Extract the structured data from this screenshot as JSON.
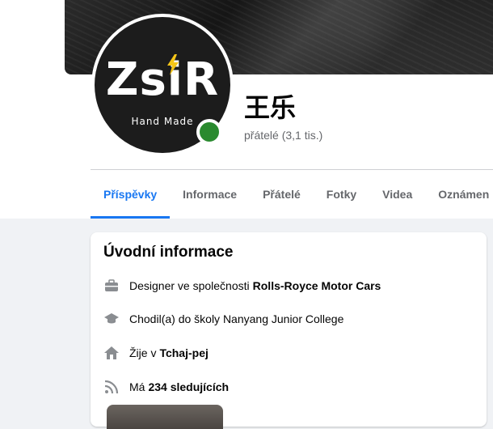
{
  "profile": {
    "name": "王乐",
    "friends_text": "přátelé (3,1 tis.)",
    "avatar_logo_text": "ZsiR",
    "avatar_logo_subtext": "Hand  Made",
    "online_color": "#2a8a2f"
  },
  "tabs": [
    {
      "label": "Příspěvky",
      "active": true
    },
    {
      "label": "Informace",
      "active": false
    },
    {
      "label": "Přátelé",
      "active": false
    },
    {
      "label": "Fotky",
      "active": false
    },
    {
      "label": "Videa",
      "active": false
    },
    {
      "label": "Oznámen",
      "active": false
    }
  ],
  "intro": {
    "title": "Úvodní informace",
    "work": {
      "prefix": "Designer ve společnosti ",
      "value": "Rolls-Royce Motor Cars",
      "icon": "briefcase-icon"
    },
    "school": {
      "prefix": "Chodil(a) do školy Nanyang Junior College",
      "icon": "graduation-cap-icon"
    },
    "home": {
      "prefix": "Žije v ",
      "value": "Tchaj-pej",
      "icon": "home-icon"
    },
    "followers": {
      "prefix": "Má ",
      "value": "234 sledujících",
      "icon": "rss-icon"
    }
  },
  "colors": {
    "accent": "#1877f2",
    "muted": "#65676b",
    "background": "#f0f2f5"
  }
}
